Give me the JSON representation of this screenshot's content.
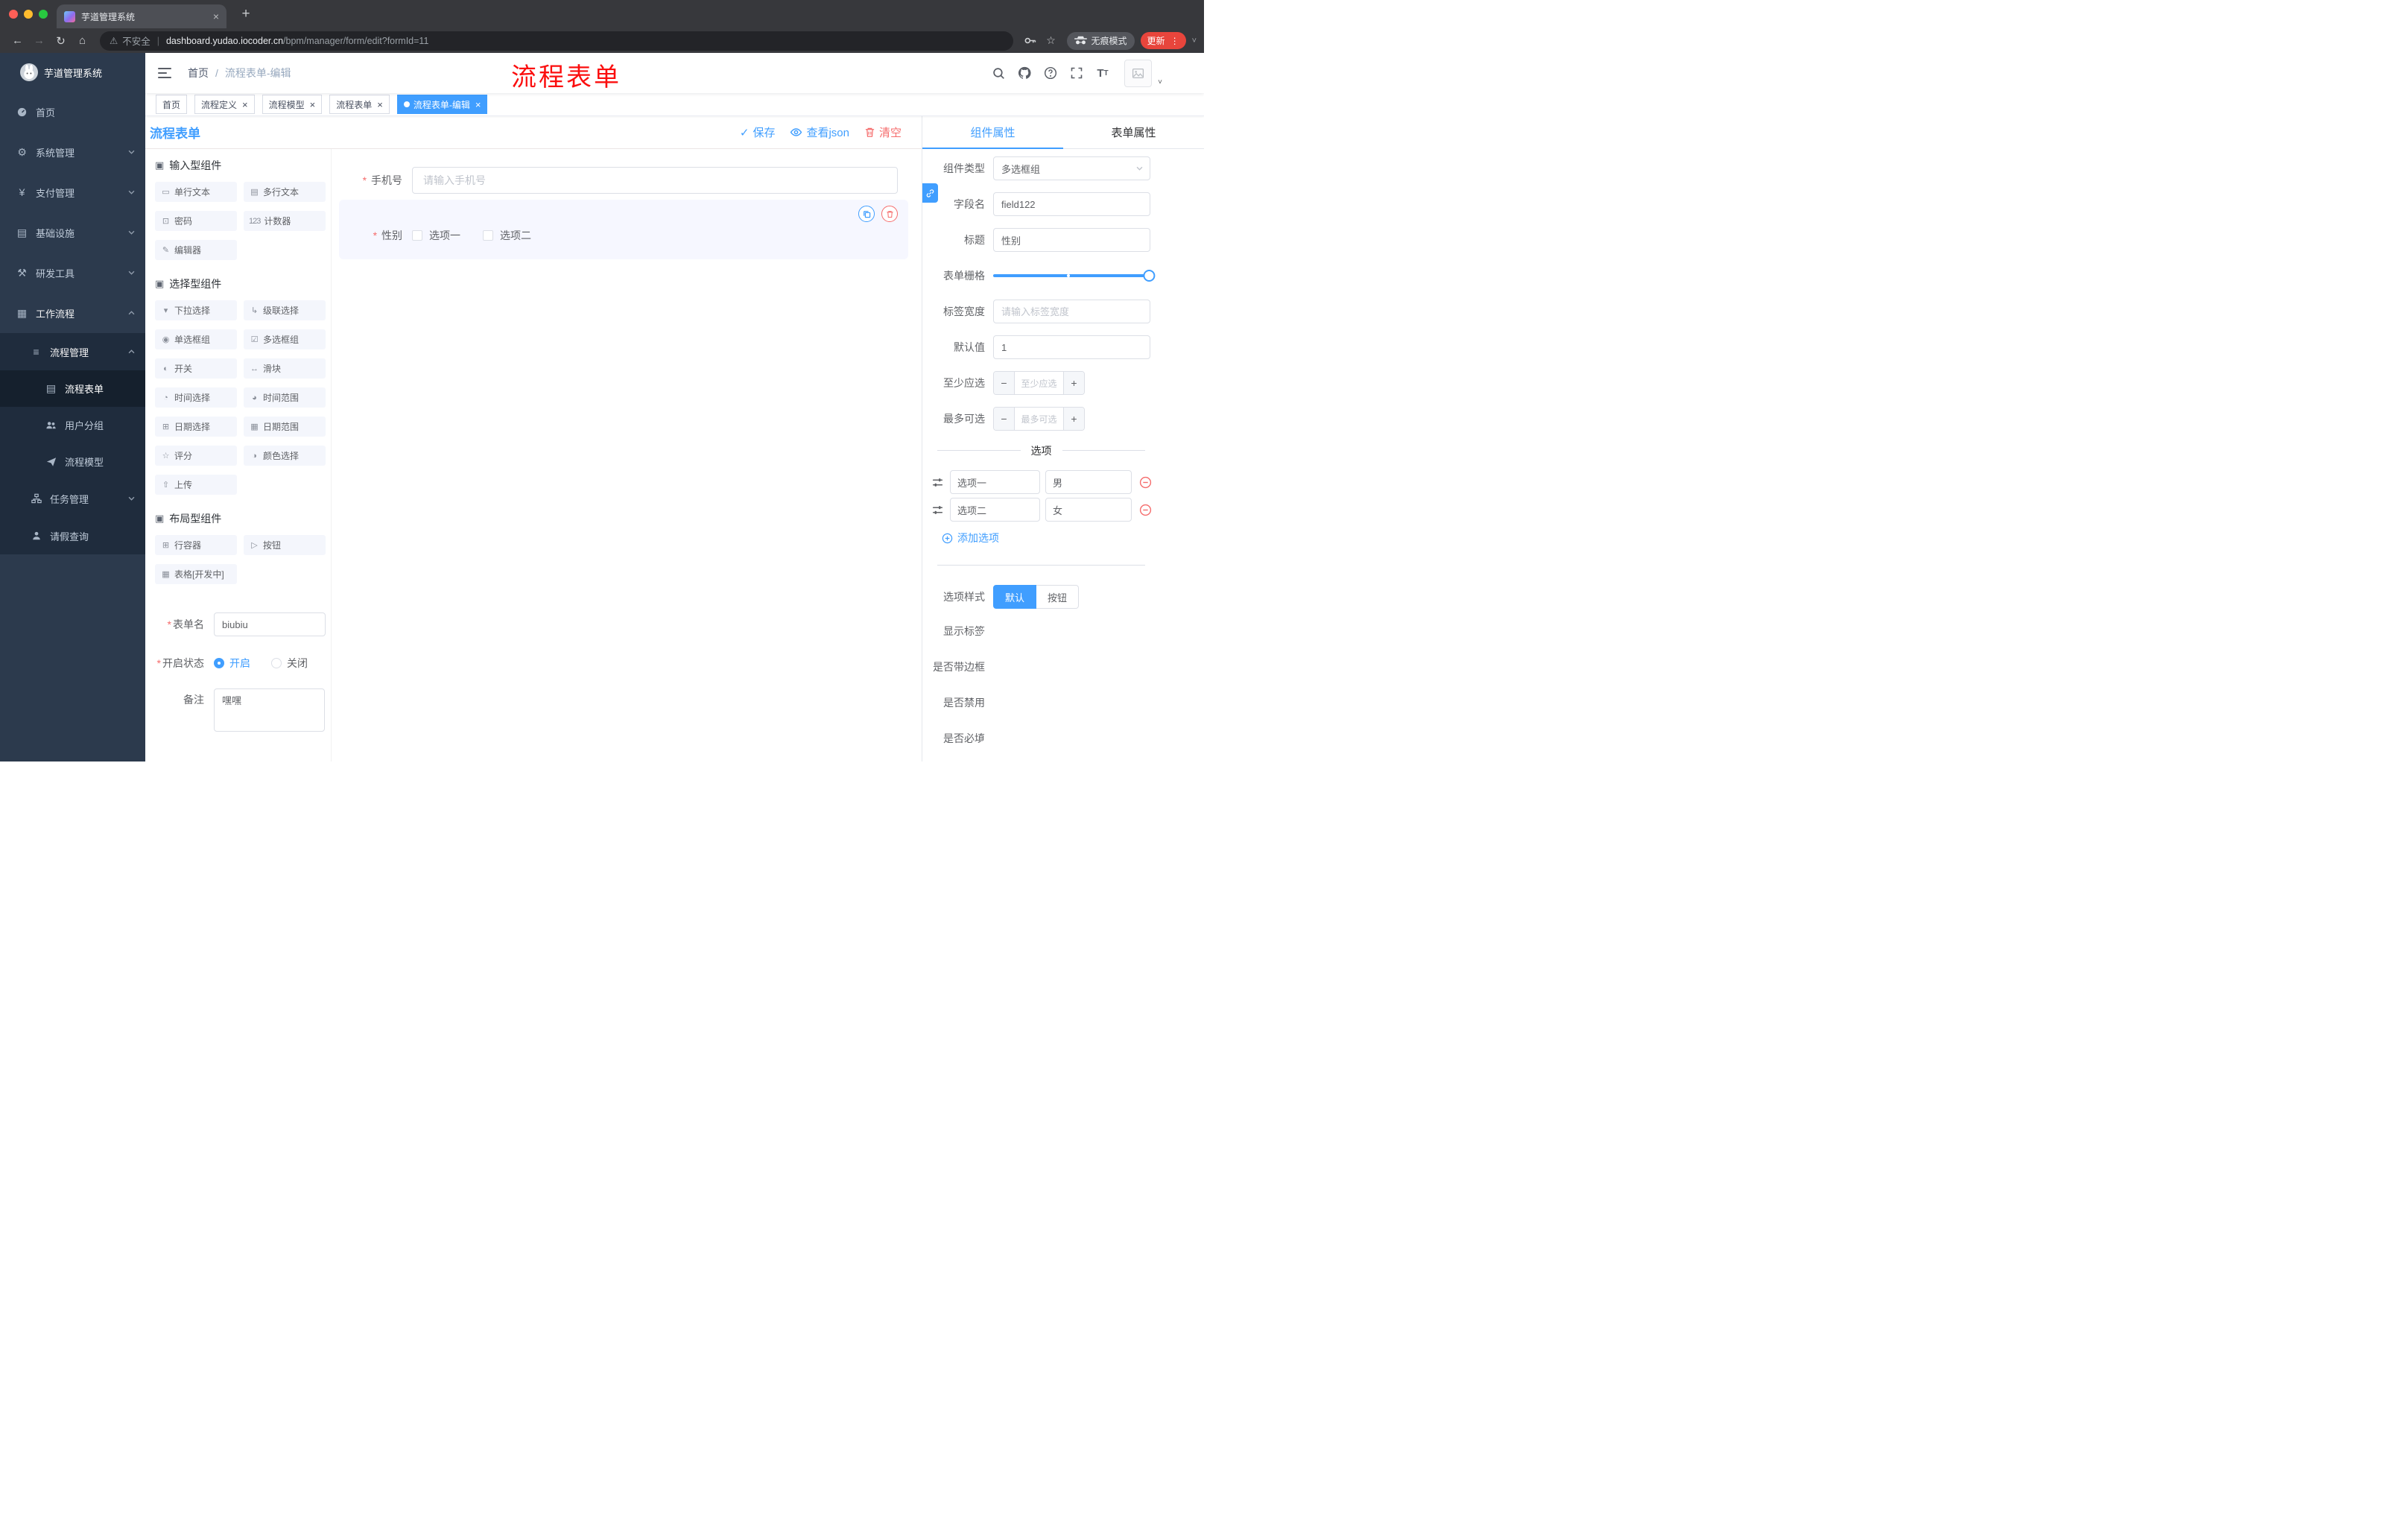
{
  "browser": {
    "tab_title": "芋道管理系统",
    "security_label": "不安全",
    "url_domain": "dashboard.yudao.iocoder.cn",
    "url_path": "/bpm/manager/form/edit?formId=11",
    "incognito_label": "无痕模式",
    "update_label": "更新"
  },
  "glyphs": {
    "back": "←",
    "forward": "→",
    "reload": "↻",
    "home": "⌂",
    "star": "☆",
    "dots": "⋮",
    "caret": "˅",
    "warning": "⚠",
    "separator": "|",
    "close": "×",
    "check": "✓",
    "slash": "/",
    "add_tab": "+",
    "minus": "−",
    "plus": "+"
  },
  "annotation": {
    "text": "流程表单",
    "color": "#fb0e0e"
  },
  "breadcrumb": {
    "home": "首页",
    "current": "流程表单-编辑"
  },
  "sidebar": {
    "logo_title": "芋道管理系统",
    "items": [
      {
        "label": "首页",
        "icon": "dashboard-icon"
      },
      {
        "label": "系统管理",
        "icon": "gear-icon",
        "glyph": "⚙"
      },
      {
        "label": "支付管理",
        "icon": "yen-icon",
        "glyph": "¥"
      },
      {
        "label": "基础设施",
        "icon": "infrastructure-icon",
        "glyph": "▤"
      },
      {
        "label": "研发工具",
        "icon": "tools-icon",
        "glyph": "⚒"
      },
      {
        "label": "工作流程",
        "icon": "workflow-icon",
        "glyph": "▦",
        "expanded": true
      },
      {
        "label": "流程管理",
        "icon": "list-icon",
        "glyph": "≡",
        "expanded": true
      },
      {
        "label": "流程表单",
        "icon": "form-icon",
        "glyph": "▤",
        "active": true
      },
      {
        "label": "用户分组",
        "icon": "users-icon"
      },
      {
        "label": "流程模型",
        "icon": "model-icon"
      },
      {
        "label": "任务管理",
        "icon": "tasks-icon"
      },
      {
        "label": "请假查询",
        "icon": "user-icon"
      }
    ]
  },
  "tags": [
    {
      "label": "首页",
      "closable": false,
      "active": false
    },
    {
      "label": "流程定义",
      "closable": true,
      "active": false
    },
    {
      "label": "流程模型",
      "closable": true,
      "active": false
    },
    {
      "label": "流程表单",
      "closable": true,
      "active": false
    },
    {
      "label": "流程表单-编辑",
      "closable": true,
      "active": true
    }
  ],
  "designer": {
    "title": "流程表单",
    "save_label": "保存",
    "view_json_label": "查看json",
    "clear_label": "清空"
  },
  "palette": {
    "sections": [
      {
        "title": "输入型组件",
        "items": [
          {
            "label": "单行文本",
            "glyph": "▭",
            "icon": "single-line-input-icon"
          },
          {
            "label": "多行文本",
            "glyph": "▤",
            "icon": "textarea-icon"
          },
          {
            "label": "密码",
            "glyph": "⊡",
            "icon": "password-icon"
          },
          {
            "label": "计数器",
            "glyph": "123",
            "icon": "counter-icon"
          },
          {
            "label": "编辑器",
            "glyph": "✎",
            "icon": "editor-icon"
          }
        ]
      },
      {
        "title": "选择型组件",
        "items": [
          {
            "label": "下拉选择",
            "glyph": "▾",
            "icon": "select-icon"
          },
          {
            "label": "级联选择",
            "glyph": "↳",
            "icon": "cascader-icon"
          },
          {
            "label": "单选框组",
            "glyph": "◉",
            "icon": "radio-group-icon"
          },
          {
            "label": "多选框组",
            "glyph": "☑",
            "icon": "checkbox-group-icon"
          },
          {
            "label": "开关",
            "glyph": "◐",
            "icon": "switch-icon"
          },
          {
            "label": "滑块",
            "glyph": "↔",
            "icon": "slider-icon"
          },
          {
            "label": "时间选择",
            "glyph": "◔",
            "icon": "time-picker-icon"
          },
          {
            "label": "时间范围",
            "glyph": "◕",
            "icon": "time-range-icon"
          },
          {
            "label": "日期选择",
            "glyph": "⊞",
            "icon": "date-picker-icon"
          },
          {
            "label": "日期范围",
            "glyph": "▦",
            "icon": "date-range-icon"
          },
          {
            "label": "评分",
            "glyph": "☆",
            "icon": "rate-icon"
          },
          {
            "label": "颜色选择",
            "glyph": "◑",
            "icon": "color-picker-icon"
          },
          {
            "label": "上传",
            "glyph": "⇧",
            "icon": "upload-icon"
          }
        ]
      },
      {
        "title": "布局型组件",
        "items": [
          {
            "label": "行容器",
            "glyph": "⊞",
            "icon": "row-container-icon"
          },
          {
            "label": "按钮",
            "glyph": "▷",
            "icon": "button-icon"
          },
          {
            "label": "表格[开发中]",
            "glyph": "▦",
            "icon": "table-icon"
          }
        ]
      }
    ],
    "form": {
      "name_label": "表单名",
      "name_value": "biubiu",
      "status_label": "开启状态",
      "status_on": "开启",
      "status_off": "关闭",
      "status_selected": "开启",
      "remark_label": "备注",
      "remark_value": "嘿嘿"
    }
  },
  "canvas": {
    "phone_label": "手机号",
    "phone_placeholder": "请输入手机号",
    "gender_label": "性别",
    "gender_option1": "选项一",
    "gender_option2": "选项二"
  },
  "props": {
    "tab_component": "组件属性",
    "tab_form": "表单属性",
    "component_type_label": "组件类型",
    "component_type_value": "多选框组",
    "field_name_label": "字段名",
    "field_name_value": "field122",
    "title_label": "标题",
    "title_value": "性别",
    "grid_label": "表单栅格",
    "label_width_label": "标签宽度",
    "label_width_placeholder": "请输入标签宽度",
    "default_label": "默认值",
    "default_value": "1",
    "min_label": "至少应选",
    "min_placeholder": "至少应选",
    "max_label": "最多可选",
    "max_placeholder": "最多可选",
    "options_title": "选项",
    "options": [
      {
        "label": "选项一",
        "value": "男"
      },
      {
        "label": "选项二",
        "value": "女"
      }
    ],
    "add_option_label": "添加选项",
    "style_label": "选项样式",
    "style_default": "默认",
    "style_button": "按钮",
    "style_selected": "默认",
    "switches": [
      {
        "label": "显示标签",
        "on": true
      },
      {
        "label": "是否带边框",
        "on": false
      },
      {
        "label": "是否禁用",
        "on": false
      },
      {
        "label": "是否必填",
        "on": true
      }
    ],
    "accent_color": "#409eff",
    "danger_color": "#f56c6c"
  }
}
